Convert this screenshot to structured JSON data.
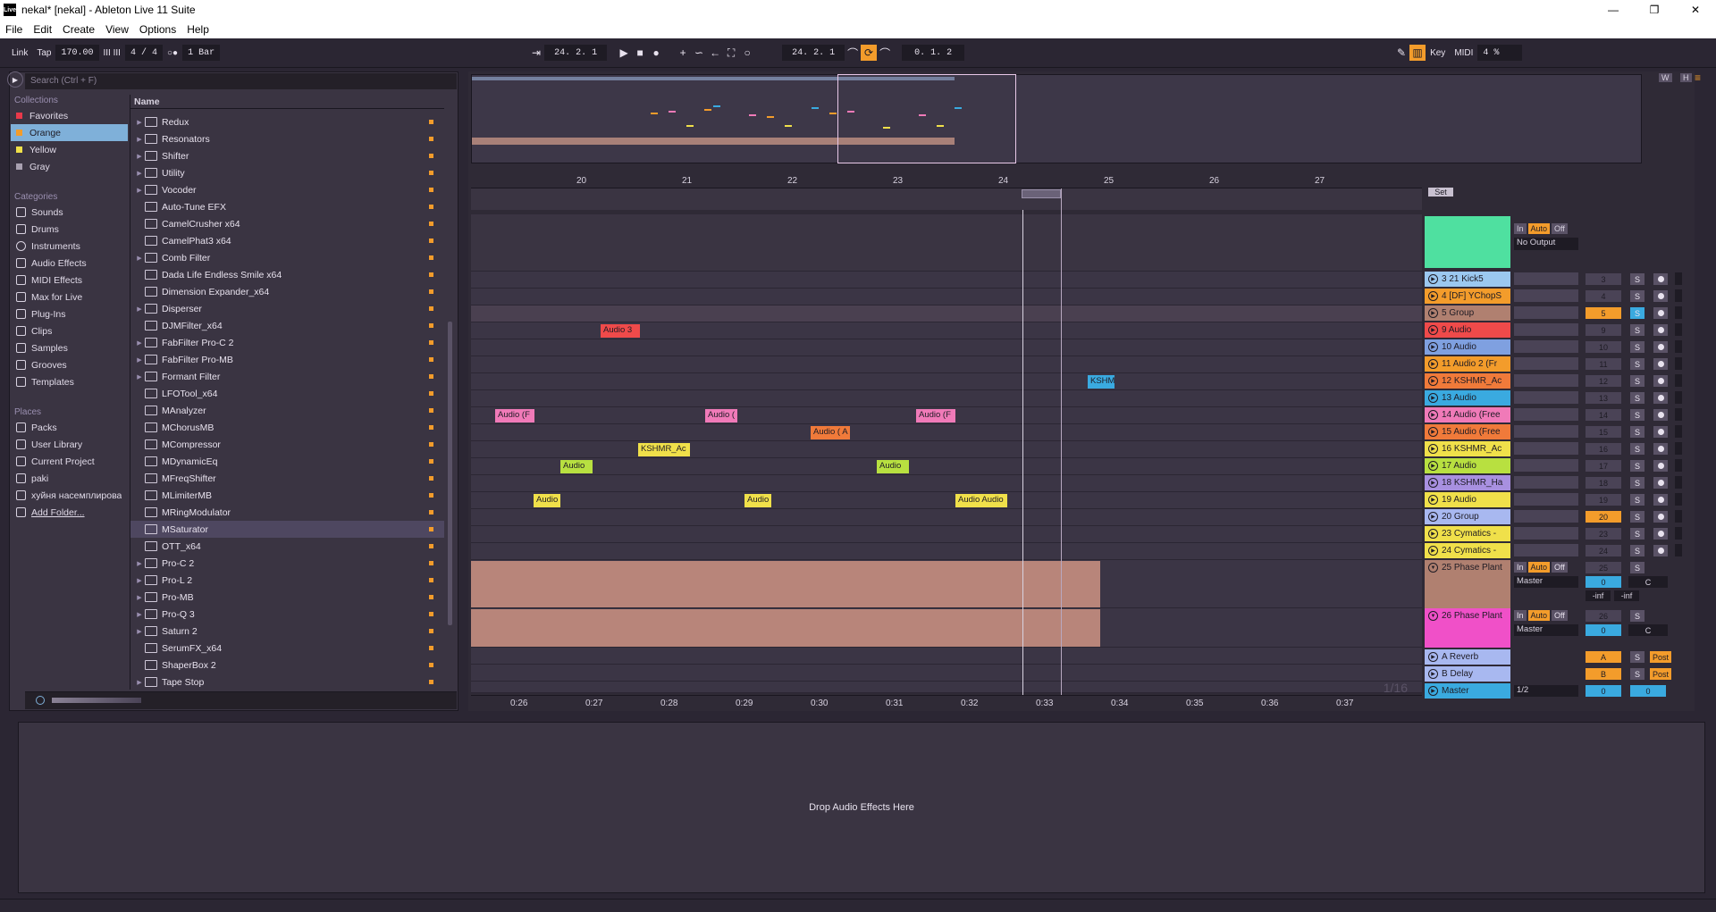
{
  "window": {
    "logo": "Live",
    "title": "nekal*  [nekal] - Ableton Live 11 Suite",
    "minimize": "—",
    "restore": "❐",
    "close": "✕"
  },
  "menu": [
    "File",
    "Edit",
    "Create",
    "View",
    "Options",
    "Help"
  ],
  "control": {
    "link": "Link",
    "tap": "Tap",
    "tempo": "170.00",
    "nudge": "III III",
    "signature": "4 / 4",
    "metronome": "○●",
    "quantize": "1 Bar",
    "arrangement_position": "24.  2.  1",
    "loop_start": "24.  2.  1",
    "loop_length": "0.  1.  2",
    "key": "Key",
    "midi": "MIDI",
    "cpu": "4 %",
    "h": "H",
    "w": "W"
  },
  "browser": {
    "search_placeholder": "Search (Ctrl + F)",
    "collections_label": "Collections",
    "collections": [
      {
        "label": "Favorites",
        "color": "#e8394a"
      },
      {
        "label": "Orange",
        "color": "#f39c2b"
      },
      {
        "label": "Yellow",
        "color": "#f0e04a"
      },
      {
        "label": "Gray",
        "color": "#a8a0b0"
      }
    ],
    "categories_label": "Categories",
    "categories": [
      "Sounds",
      "Drums",
      "Instruments",
      "Audio Effects",
      "MIDI Effects",
      "Max for Live",
      "Plug-Ins",
      "Clips",
      "Samples",
      "Grooves",
      "Templates"
    ],
    "places_label": "Places",
    "places": [
      "Packs",
      "User Library",
      "Current Project",
      "paki",
      "хуйня насемплирова",
      "Add Folder..."
    ],
    "column_name": "Name",
    "items": [
      {
        "label": "Redux",
        "folder": true
      },
      {
        "label": "Resonators",
        "folder": true
      },
      {
        "label": "Shifter",
        "folder": true
      },
      {
        "label": "Utility",
        "folder": true
      },
      {
        "label": "Vocoder",
        "folder": true
      },
      {
        "label": "Auto-Tune EFX",
        "folder": false
      },
      {
        "label": "CamelCrusher x64",
        "folder": false
      },
      {
        "label": "CamelPhat3 x64",
        "folder": false
      },
      {
        "label": "Comb Filter",
        "folder": true
      },
      {
        "label": "Dada Life Endless Smile x64",
        "folder": false
      },
      {
        "label": "Dimension Expander_x64",
        "folder": false
      },
      {
        "label": "Disperser",
        "folder": true
      },
      {
        "label": "DJMFilter_x64",
        "folder": false
      },
      {
        "label": "FabFilter Pro-C 2",
        "folder": true
      },
      {
        "label": "FabFilter Pro-MB",
        "folder": true
      },
      {
        "label": "Formant Filter",
        "folder": true
      },
      {
        "label": "LFOTool_x64",
        "folder": false
      },
      {
        "label": "MAnalyzer",
        "folder": false
      },
      {
        "label": "MChorusMB",
        "folder": false
      },
      {
        "label": "MCompressor",
        "folder": false
      },
      {
        "label": "MDynamicEq",
        "folder": false
      },
      {
        "label": "MFreqShifter",
        "folder": false
      },
      {
        "label": "MLimiterMB",
        "folder": false
      },
      {
        "label": "MRingModulator",
        "folder": false
      },
      {
        "label": "MSaturator",
        "folder": false,
        "selected": true
      },
      {
        "label": "OTT_x64",
        "folder": false
      },
      {
        "label": "Pro-C 2",
        "folder": true
      },
      {
        "label": "Pro-L 2",
        "folder": true
      },
      {
        "label": "Pro-MB",
        "folder": true
      },
      {
        "label": "Pro-Q 3",
        "folder": true
      },
      {
        "label": "Saturn 2",
        "folder": true
      },
      {
        "label": "SerumFX_x64",
        "folder": false
      },
      {
        "label": "ShaperBox 2",
        "folder": false
      },
      {
        "label": "Tape Stop",
        "folder": true
      }
    ]
  },
  "arrangement": {
    "bars": [
      "20",
      "21",
      "22",
      "23",
      "24",
      "25",
      "26",
      "27"
    ],
    "times": [
      "0:26",
      "0:27",
      "0:28",
      "0:29",
      "0:30",
      "0:31",
      "0:32",
      "0:33",
      "0:34",
      "0:35",
      "0:36",
      "0:37"
    ],
    "set_label": "Set",
    "grid": "1/16",
    "clip_audio3": "Audio 3",
    "clip_kshmr": "KSHMR",
    "clip_audio_f1": "Audio (F",
    "clip_audio_f2": "Audio (",
    "clip_audio_f3": "Audio (F",
    "clip_audio_a": "Audio ( A",
    "clip_kshmr_ac": "KSHMR_Ac",
    "clip_audio_green1": "Audio",
    "clip_audio_green2": "Audio",
    "clip_audio_y1": "Audio",
    "clip_audio_y2": "Audio",
    "clip_audio_y3": "Audio Audio"
  },
  "tracks": [
    {
      "name": "3 21 Kick5",
      "color": "#9bc8f0",
      "num": "3"
    },
    {
      "name": "4 [DF] YChopS",
      "color": "#f39c2b",
      "num": "4"
    },
    {
      "name": "5 Group",
      "color": "#b08070",
      "num": "5"
    },
    {
      "name": "9 Audio",
      "color": "#ef4a4a",
      "num": "9"
    },
    {
      "name": "10 Audio",
      "color": "#7fa0e0",
      "num": "10"
    },
    {
      "name": "11 Audio 2 (Fr",
      "color": "#f39c2b",
      "num": "11"
    },
    {
      "name": "12 KSHMR_Ac",
      "color": "#f07a3a",
      "num": "12"
    },
    {
      "name": "13 Audio",
      "color": "#3aaae0",
      "num": "13"
    },
    {
      "name": "14 Audio (Free",
      "color": "#f07ab8",
      "num": "14"
    },
    {
      "name": "15 Audio (Free",
      "color": "#f07a3a",
      "num": "15"
    },
    {
      "name": "16 KSHMR_Ac",
      "color": "#f0e04a",
      "num": "16"
    },
    {
      "name": "17 Audio",
      "color": "#b8e040",
      "num": "17"
    },
    {
      "name": "18 KSHMR_Ha",
      "color": "#a890e0",
      "num": "18"
    },
    {
      "name": "19 Audio",
      "color": "#f0e04a",
      "num": "19"
    },
    {
      "name": "20 Group",
      "color": "#a8b8f0",
      "num": "20"
    },
    {
      "name": "23 Cymatics -",
      "color": "#f0e04a",
      "num": "23"
    },
    {
      "name": "24 Cymatics -",
      "color": "#f0e04a",
      "num": "24"
    }
  ],
  "big_tracks": [
    {
      "name": "25 Phase Plant",
      "color": "#b08070",
      "num": "25",
      "in": "In",
      "auto": "Auto",
      "off": "Off",
      "out": "Master",
      "vol": "0",
      "pan": "C",
      "inf1": "-inf",
      "inf2": "-inf"
    },
    {
      "name": "26 Phase Plant",
      "color": "#f050c8",
      "num": "26",
      "in": "In",
      "auto": "Auto",
      "off": "Off",
      "out": "Master",
      "vol": "0",
      "pan": "C"
    }
  ],
  "returns": [
    {
      "name": "A Reverb",
      "color": "#a8b8f0",
      "letter": "A",
      "post": "Post"
    },
    {
      "name": "B Delay",
      "color": "#a8b8f0",
      "letter": "B",
      "post": "Post"
    },
    {
      "name": "Master",
      "color": "#3aaae0",
      "cue": "1/2",
      "vol": "0",
      "pan": "0"
    }
  ],
  "top_track": {
    "in": "In",
    "auto": "Auto",
    "off": "Off",
    "output": "No Output"
  },
  "solo": "S",
  "device_drop": "Drop Audio Effects Here"
}
